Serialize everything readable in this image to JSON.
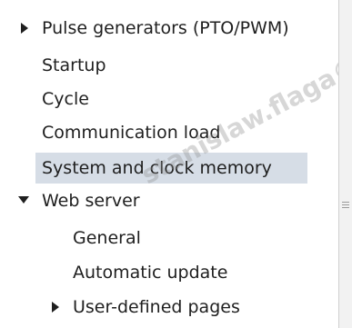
{
  "tree": {
    "items": [
      {
        "label": "Pulse generators (PTO/PWM)",
        "expander": "collapsed"
      },
      {
        "label": "Startup",
        "expander": "none"
      },
      {
        "label": "Cycle",
        "expander": "none"
      },
      {
        "label": "Communication load",
        "expander": "none"
      },
      {
        "label": "System and clock memory",
        "expander": "none",
        "selected": true
      },
      {
        "label": "Web server",
        "expander": "expanded"
      },
      {
        "label": "General",
        "expander": "none"
      },
      {
        "label": "Automatic update",
        "expander": "none"
      },
      {
        "label": "User-defined pages",
        "expander": "collapsed"
      }
    ]
  },
  "watermark": {
    "text": "stanislaw.flaga©"
  },
  "colors": {
    "selection": "#d6dde6",
    "text": "#1f1f1f",
    "arrow": "#1f1f1f",
    "scrollbar": "#f2f2f2"
  },
  "icons": {
    "collapsed": "triangle-right-icon",
    "expanded": "triangle-down-icon",
    "scroll_grip": "grip-lines-icon"
  }
}
